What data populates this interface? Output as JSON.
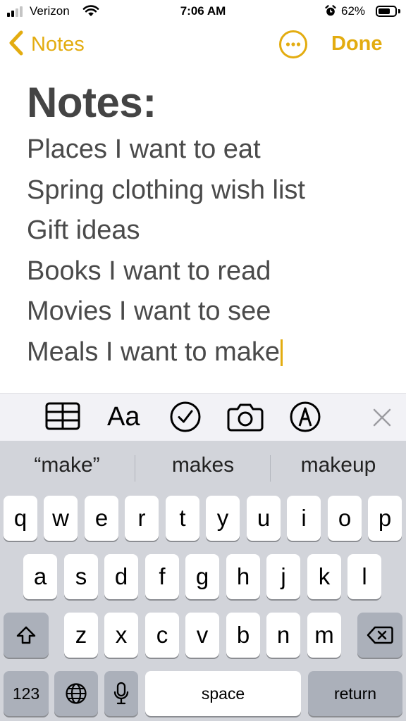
{
  "status_bar": {
    "carrier": "Verizon",
    "time": "7:06 AM",
    "battery_percent": "62%",
    "battery_level": 0.62,
    "signal_bars": 2,
    "icons": [
      "signal-icon",
      "wifi-icon",
      "alarm-icon",
      "battery-icon"
    ]
  },
  "nav": {
    "back_label": "Notes",
    "done_label": "Done",
    "icons": [
      "chevron-left-icon",
      "more-icon"
    ]
  },
  "note": {
    "title": "Notes:",
    "lines": [
      "Places I want to eat",
      "Spring clothing wish list",
      "Gift ideas",
      "Books I want to read",
      "Movies I want to see",
      "Meals I want to make"
    ]
  },
  "toolbar": {
    "format_label": "Aa",
    "icons": [
      "table-icon",
      "format-icon",
      "checklist-icon",
      "camera-icon",
      "markup-icon",
      "close-icon"
    ]
  },
  "keyboard": {
    "suggestions": [
      "“make”",
      "makes",
      "makeup"
    ],
    "row1": [
      "q",
      "w",
      "e",
      "r",
      "t",
      "y",
      "u",
      "i",
      "o",
      "p"
    ],
    "row2": [
      "a",
      "s",
      "d",
      "f",
      "g",
      "h",
      "j",
      "k",
      "l"
    ],
    "row3": [
      "z",
      "x",
      "c",
      "v",
      "b",
      "n",
      "m"
    ],
    "numbers_label": "123",
    "space_label": "space",
    "return_label": "return",
    "icons": [
      "shift-icon",
      "delete-icon",
      "globe-icon",
      "microphone-icon"
    ]
  },
  "colors": {
    "accent": "#e3ac10",
    "note_text": "#4a4a4a",
    "keyboard_bg": "#d2d4da",
    "toolbar_bg": "#f2f2f6"
  }
}
